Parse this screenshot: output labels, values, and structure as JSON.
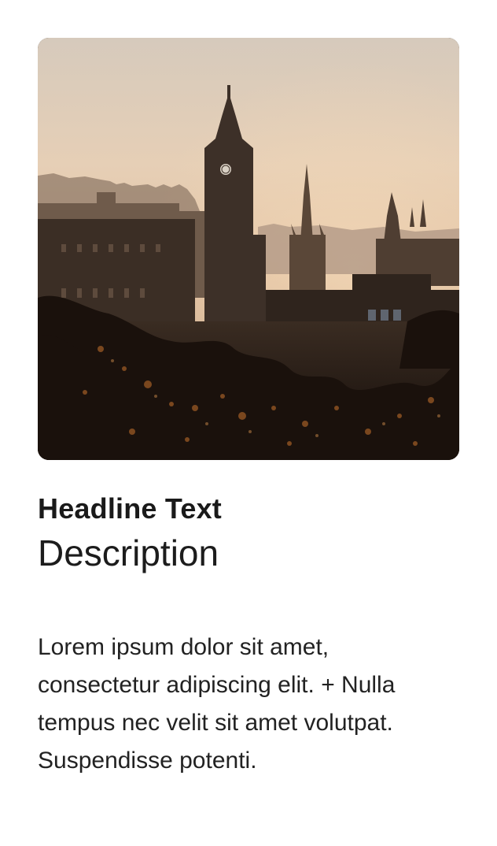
{
  "card": {
    "headline": "Headline Text",
    "description": "Description",
    "body": "Lorem ipsum dolor sit amet, consectetur adipiscing elit. + Nulla tempus nec velit sit amet volutpat. Suspendisse potenti."
  },
  "image": {
    "subject": "sunset city skyline with clock tower and church spire",
    "palette": {
      "sky_top": "#d8cbbd",
      "sky_mid": "#e9cdb0",
      "haze": "#c9ab8d",
      "buildings_far": "#8a7665",
      "buildings_mid": "#4c3d33",
      "buildings_near": "#2b2019",
      "foliage": "#1a110c",
      "foliage_highlight": "#9a5a25"
    }
  }
}
